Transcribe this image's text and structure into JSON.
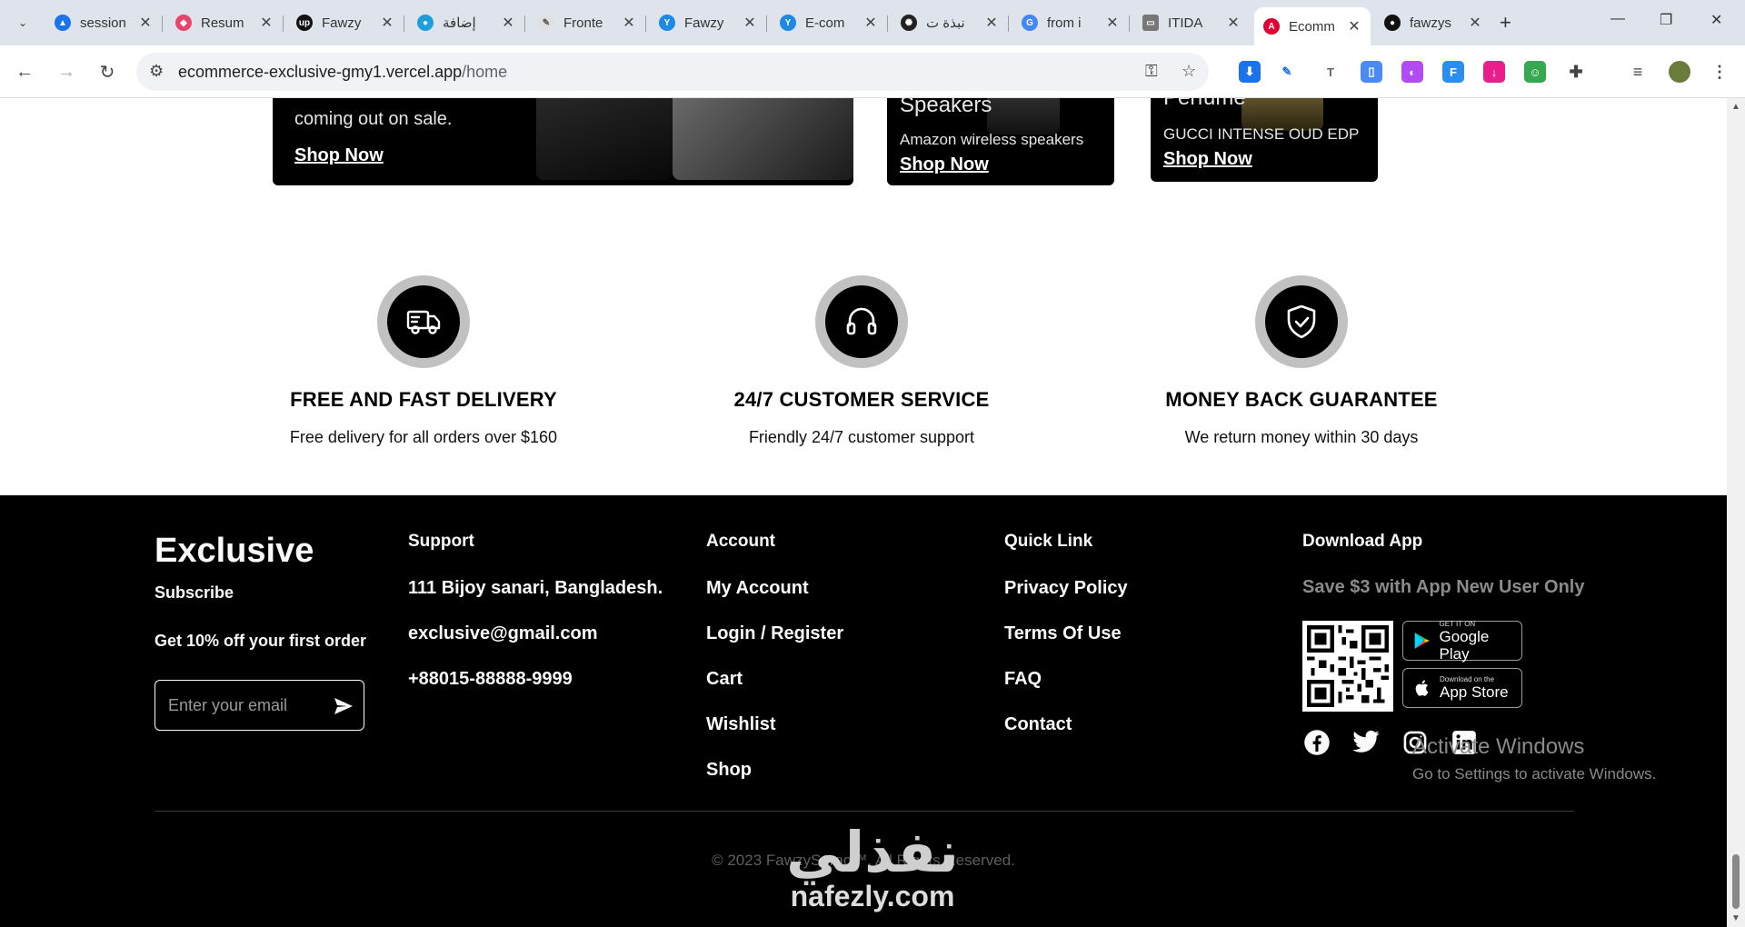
{
  "browser": {
    "tabs": [
      {
        "label": "session",
        "fav_color": "#1a73e8",
        "fav_glyph": "▲"
      },
      {
        "label": "Resum",
        "fav_color": "#e8456b",
        "fav_glyph": "◆"
      },
      {
        "label": "Fawzy",
        "fav_color": "#111111",
        "fav_glyph": "up"
      },
      {
        "label": "إضافة",
        "fav_color": "#1e9fdb",
        "fav_glyph": "●"
      },
      {
        "label": "Fronte",
        "fav_color": "#e0e0e0",
        "fav_glyph": "✎"
      },
      {
        "label": "Fawzy",
        "fav_color": "#1e88e5",
        "fav_glyph": "Y"
      },
      {
        "label": "E-com",
        "fav_color": "#1e88e5",
        "fav_glyph": "Y"
      },
      {
        "label": "نبذة ت",
        "fav_color": "#222222",
        "fav_glyph": "✺"
      },
      {
        "label": "from i",
        "fav_color": "#4285f4",
        "fav_glyph": "G"
      },
      {
        "label": "ITIDA",
        "fav_color": "#777777",
        "fav_glyph": "▭"
      },
      {
        "label": "Ecomm",
        "fav_color": "#dd0031",
        "fav_glyph": "A"
      },
      {
        "label": "fawzys",
        "fav_color": "#111111",
        "fav_glyph": "●"
      }
    ],
    "url_host": "ecommerce-exclusive-gmy1.vercel.app",
    "url_path": "/home"
  },
  "promos": {
    "card1_text": "coming out on sale.",
    "card1_link": "Shop Now",
    "card2_title": "Speakers",
    "card2_text": "Amazon wireless speakers",
    "card2_link": "Shop Now",
    "card3_title": "Perfume",
    "card3_text": "GUCCI INTENSE OUD EDP",
    "card3_link": "Shop Now"
  },
  "services": [
    {
      "title": "FREE AND FAST DELIVERY",
      "desc": "Free delivery for all orders over $160",
      "icon": "truck-icon"
    },
    {
      "title": "24/7 CUSTOMER SERVICE",
      "desc": "Friendly 24/7 customer support",
      "icon": "headset-icon"
    },
    {
      "title": "MONEY BACK GUARANTEE",
      "desc": "We return money within 30 days",
      "icon": "shield-check-icon"
    }
  ],
  "footer": {
    "brand": "Exclusive",
    "subscribe": "Subscribe",
    "offer": "Get 10% off your first order",
    "email_placeholder": "Enter your email",
    "support": {
      "heading": "Support",
      "address": "111 Bijoy sanari, Bangladesh.",
      "email": "exclusive@gmail.com",
      "phone": "+88015-88888-9999"
    },
    "account": {
      "heading": "Account",
      "links": [
        "My Account",
        "Login / Register",
        "Cart",
        "Wishlist",
        "Shop"
      ]
    },
    "quick": {
      "heading": "Quick Link",
      "links": [
        "Privacy Policy",
        "Terms Of Use",
        "FAQ",
        "Contact"
      ]
    },
    "download": {
      "heading": "Download App",
      "note": "Save $3 with App New User Only",
      "google_small": "GET IT ON",
      "google_big": "Google Play",
      "apple_small": "Download on the",
      "apple_big": "App Store"
    },
    "copyright": "© 2023 FawzySerag™. All Rights Reserved."
  },
  "os_overlay": {
    "activate_title": "Activate Windows",
    "activate_sub": "Go to Settings to activate Windows."
  },
  "watermark": {
    "arabic": "نفذلي",
    "latin": "nafezly.com"
  }
}
